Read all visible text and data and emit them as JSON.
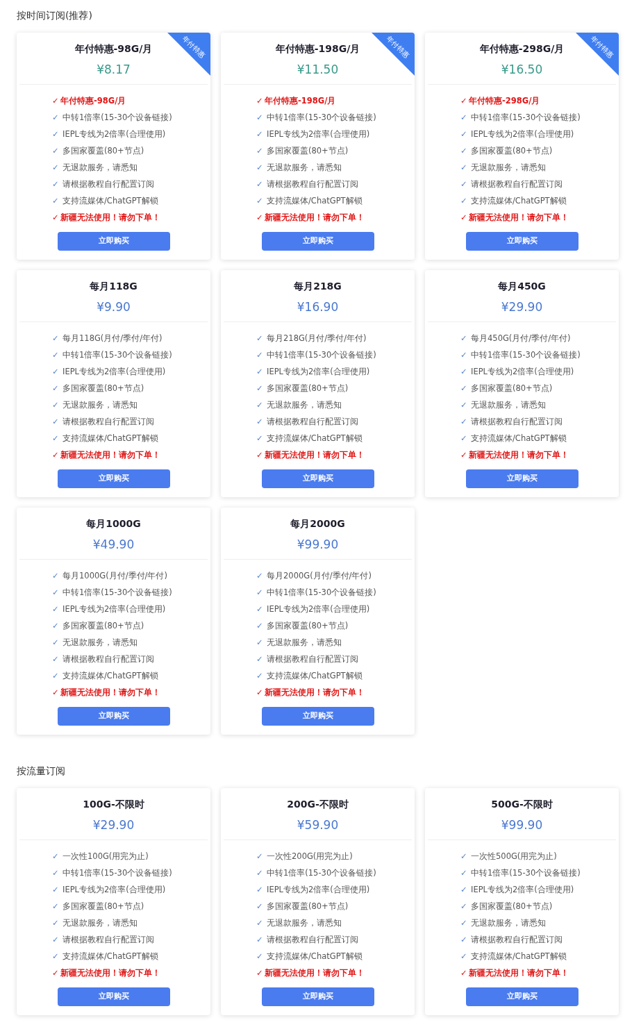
{
  "sections": [
    {
      "title": "按时间订阅(推荐)",
      "plans": [
        {
          "name": "年付特惠-98G/月",
          "price": "¥8.17",
          "color": "#3a9a8a",
          "ribbon": "年付特惠",
          "features": [
            {
              "kind": "alert",
              "check": "✓",
              "text": "年付特惠-98G/月"
            },
            {
              "kind": "normal",
              "check": "✓",
              "text": "中转1倍率(15-30个设备链接)"
            },
            {
              "kind": "normal",
              "check": "✓",
              "text": "IEPL专线为2倍率(合理使用)"
            },
            {
              "kind": "normal",
              "check": "✓",
              "text": "多国家覆盖(80+节点)"
            },
            {
              "kind": "normal",
              "check": "✓",
              "text": "无退款服务，请悉知"
            },
            {
              "kind": "normal",
              "check": "✓",
              "text": "请根据教程自行配置订阅"
            },
            {
              "kind": "normal",
              "check": "✓",
              "text": "支持流媒体/ChatGPT解锁"
            },
            {
              "kind": "alert",
              "check": "✓",
              "text": "新疆无法使用！请勿下单！"
            }
          ],
          "button": "立即购买"
        },
        {
          "name": "年付特惠-198G/月",
          "price": "¥11.50",
          "color": "#3a9a8a",
          "ribbon": "年付特惠",
          "features": [
            {
              "kind": "alert",
              "check": "✓",
              "text": "年付特惠-198G/月"
            },
            {
              "kind": "normal",
              "check": "✓",
              "text": "中转1倍率(15-30个设备链接)"
            },
            {
              "kind": "normal",
              "check": "✓",
              "text": "IEPL专线为2倍率(合理使用)"
            },
            {
              "kind": "normal",
              "check": "✓",
              "text": "多国家覆盖(80+节点)"
            },
            {
              "kind": "normal",
              "check": "✓",
              "text": "无退款服务，请悉知"
            },
            {
              "kind": "normal",
              "check": "✓",
              "text": "请根据教程自行配置订阅"
            },
            {
              "kind": "normal",
              "check": "✓",
              "text": "支持流媒体/ChatGPT解锁"
            },
            {
              "kind": "alert",
              "check": "✓",
              "text": "新疆无法使用！请勿下单！"
            }
          ],
          "button": "立即购买"
        },
        {
          "name": "年付特惠-298G/月",
          "price": "¥16.50",
          "color": "#3a9a8a",
          "ribbon": "年付特惠",
          "features": [
            {
              "kind": "alert",
              "check": "✓",
              "text": "年付特惠-298G/月"
            },
            {
              "kind": "normal",
              "check": "✓",
              "text": "中转1倍率(15-30个设备链接)"
            },
            {
              "kind": "normal",
              "check": "✓",
              "text": "IEPL专线为2倍率(合理使用)"
            },
            {
              "kind": "normal",
              "check": "✓",
              "text": "多国家覆盖(80+节点)"
            },
            {
              "kind": "normal",
              "check": "✓",
              "text": "无退款服务，请悉知"
            },
            {
              "kind": "normal",
              "check": "✓",
              "text": "请根据教程自行配置订阅"
            },
            {
              "kind": "normal",
              "check": "✓",
              "text": "支持流媒体/ChatGPT解锁"
            },
            {
              "kind": "alert",
              "check": "✓",
              "text": "新疆无法使用！请勿下单！"
            }
          ],
          "button": "立即购买"
        },
        {
          "name": "每月118G",
          "price": "¥9.90",
          "color": "#4a78d0",
          "features": [
            {
              "kind": "normal",
              "check": "✓",
              "text": "每月118G(月付/季付/年付)"
            },
            {
              "kind": "normal",
              "check": "✓",
              "text": "中转1倍率(15-30个设备链接)"
            },
            {
              "kind": "normal",
              "check": "✓",
              "text": "IEPL专线为2倍率(合理使用)"
            },
            {
              "kind": "normal",
              "check": "✓",
              "text": "多国家覆盖(80+节点)"
            },
            {
              "kind": "normal",
              "check": "✓",
              "text": "无退款服务，请悉知"
            },
            {
              "kind": "normal",
              "check": "✓",
              "text": "请根据教程自行配置订阅"
            },
            {
              "kind": "normal",
              "check": "✓",
              "text": "支持流媒体/ChatGPT解锁"
            },
            {
              "kind": "alert",
              "check": "✓",
              "text": "新疆无法使用！请勿下单！"
            }
          ],
          "button": "立即购买"
        },
        {
          "name": "每月218G",
          "price": "¥16.90",
          "color": "#4a78d0",
          "features": [
            {
              "kind": "normal",
              "check": "✓",
              "text": "每月218G(月付/季付/年付)"
            },
            {
              "kind": "normal",
              "check": "✓",
              "text": "中转1倍率(15-30个设备链接)"
            },
            {
              "kind": "normal",
              "check": "✓",
              "text": "IEPL专线为2倍率(合理使用)"
            },
            {
              "kind": "normal",
              "check": "✓",
              "text": "多国家覆盖(80+节点)"
            },
            {
              "kind": "normal",
              "check": "✓",
              "text": "无退款服务，请悉知"
            },
            {
              "kind": "normal",
              "check": "✓",
              "text": "请根据教程自行配置订阅"
            },
            {
              "kind": "normal",
              "check": "✓",
              "text": "支持流媒体/ChatGPT解锁"
            },
            {
              "kind": "alert",
              "check": "✓",
              "text": "新疆无法使用！请勿下单！"
            }
          ],
          "button": "立即购买"
        },
        {
          "name": "每月450G",
          "price": "¥29.90",
          "color": "#4a78d0",
          "features": [
            {
              "kind": "normal",
              "check": "✓",
              "text": "每月450G(月付/季付/年付)"
            },
            {
              "kind": "normal",
              "check": "✓",
              "text": "中转1倍率(15-30个设备链接)"
            },
            {
              "kind": "normal",
              "check": "✓",
              "text": "IEPL专线为2倍率(合理使用)"
            },
            {
              "kind": "normal",
              "check": "✓",
              "text": "多国家覆盖(80+节点)"
            },
            {
              "kind": "normal",
              "check": "✓",
              "text": "无退款服务，请悉知"
            },
            {
              "kind": "normal",
              "check": "✓",
              "text": "请根据教程自行配置订阅"
            },
            {
              "kind": "normal",
              "check": "✓",
              "text": "支持流媒体/ChatGPT解锁"
            },
            {
              "kind": "alert",
              "check": "✓",
              "text": "新疆无法使用！请勿下单！"
            }
          ],
          "button": "立即购买"
        },
        {
          "name": "每月1000G",
          "price": "¥49.90",
          "color": "#4a78d0",
          "features": [
            {
              "kind": "normal",
              "check": "✓",
              "text": "每月1000G(月付/季付/年付)"
            },
            {
              "kind": "normal",
              "check": "✓",
              "text": "中转1倍率(15-30个设备链接)"
            },
            {
              "kind": "normal",
              "check": "✓",
              "text": "IEPL专线为2倍率(合理使用)"
            },
            {
              "kind": "normal",
              "check": "✓",
              "text": "多国家覆盖(80+节点)"
            },
            {
              "kind": "normal",
              "check": "✓",
              "text": "无退款服务，请悉知"
            },
            {
              "kind": "normal",
              "check": "✓",
              "text": "请根据教程自行配置订阅"
            },
            {
              "kind": "normal",
              "check": "✓",
              "text": "支持流媒体/ChatGPT解锁"
            },
            {
              "kind": "alert",
              "check": "✓",
              "text": "新疆无法使用！请勿下单！"
            }
          ],
          "button": "立即购买"
        },
        {
          "name": "每月2000G",
          "price": "¥99.90",
          "color": "#4a78d0",
          "features": [
            {
              "kind": "normal",
              "check": "✓",
              "text": "每月2000G(月付/季付/年付)"
            },
            {
              "kind": "normal",
              "check": "✓",
              "text": "中转1倍率(15-30个设备链接)"
            },
            {
              "kind": "normal",
              "check": "✓",
              "text": "IEPL专线为2倍率(合理使用)"
            },
            {
              "kind": "normal",
              "check": "✓",
              "text": "多国家覆盖(80+节点)"
            },
            {
              "kind": "normal",
              "check": "✓",
              "text": "无退款服务，请悉知"
            },
            {
              "kind": "normal",
              "check": "✓",
              "text": "请根据教程自行配置订阅"
            },
            {
              "kind": "normal",
              "check": "✓",
              "text": "支持流媒体/ChatGPT解锁"
            },
            {
              "kind": "alert",
              "check": "✓",
              "text": "新疆无法使用！请勿下单！"
            }
          ],
          "button": "立即购买"
        }
      ]
    },
    {
      "title": "按流量订阅",
      "plans": [
        {
          "name": "100G-不限时",
          "price": "¥29.90",
          "color": "#4a78d0",
          "features": [
            {
              "kind": "normal",
              "check": "✓",
              "text": "一次性100G(用完为止)"
            },
            {
              "kind": "normal",
              "check": "✓",
              "text": "中转1倍率(15-30个设备链接)"
            },
            {
              "kind": "normal",
              "check": "✓",
              "text": "IEPL专线为2倍率(合理使用)"
            },
            {
              "kind": "normal",
              "check": "✓",
              "text": "多国家覆盖(80+节点)"
            },
            {
              "kind": "normal",
              "check": "✓",
              "text": "无退款服务，请悉知"
            },
            {
              "kind": "normal",
              "check": "✓",
              "text": "请根据教程自行配置订阅"
            },
            {
              "kind": "normal",
              "check": "✓",
              "text": "支持流媒体/ChatGPT解锁"
            },
            {
              "kind": "alert",
              "check": "✓",
              "text": "新疆无法使用！请勿下单！"
            }
          ],
          "button": "立即购买"
        },
        {
          "name": "200G-不限时",
          "price": "¥59.90",
          "color": "#4a78d0",
          "features": [
            {
              "kind": "normal",
              "check": "✓",
              "text": "一次性200G(用完为止)"
            },
            {
              "kind": "normal",
              "check": "✓",
              "text": "中转1倍率(15-30个设备链接)"
            },
            {
              "kind": "normal",
              "check": "✓",
              "text": "IEPL专线为2倍率(合理使用)"
            },
            {
              "kind": "normal",
              "check": "✓",
              "text": "多国家覆盖(80+节点)"
            },
            {
              "kind": "normal",
              "check": "✓",
              "text": "无退款服务，请悉知"
            },
            {
              "kind": "normal",
              "check": "✓",
              "text": "请根据教程自行配置订阅"
            },
            {
              "kind": "normal",
              "check": "✓",
              "text": "支持流媒体/ChatGPT解锁"
            },
            {
              "kind": "alert",
              "check": "✓",
              "text": "新疆无法使用！请勿下单！"
            }
          ],
          "button": "立即购买"
        },
        {
          "name": "500G-不限时",
          "price": "¥99.90",
          "color": "#4a78d0",
          "features": [
            {
              "kind": "normal",
              "check": "✓",
              "text": "一次性500G(用完为止)"
            },
            {
              "kind": "normal",
              "check": "✓",
              "text": "中转1倍率(15-30个设备链接)"
            },
            {
              "kind": "normal",
              "check": "✓",
              "text": "IEPL专线为2倍率(合理使用)"
            },
            {
              "kind": "normal",
              "check": "✓",
              "text": "多国家覆盖(80+节点)"
            },
            {
              "kind": "normal",
              "check": "✓",
              "text": "无退款服务，请悉知"
            },
            {
              "kind": "normal",
              "check": "✓",
              "text": "请根据教程自行配置订阅"
            },
            {
              "kind": "normal",
              "check": "✓",
              "text": "支持流媒体/ChatGPT解锁"
            },
            {
              "kind": "alert",
              "check": "✓",
              "text": "新疆无法使用！请勿下单！"
            }
          ],
          "button": "立即购买"
        }
      ]
    }
  ]
}
